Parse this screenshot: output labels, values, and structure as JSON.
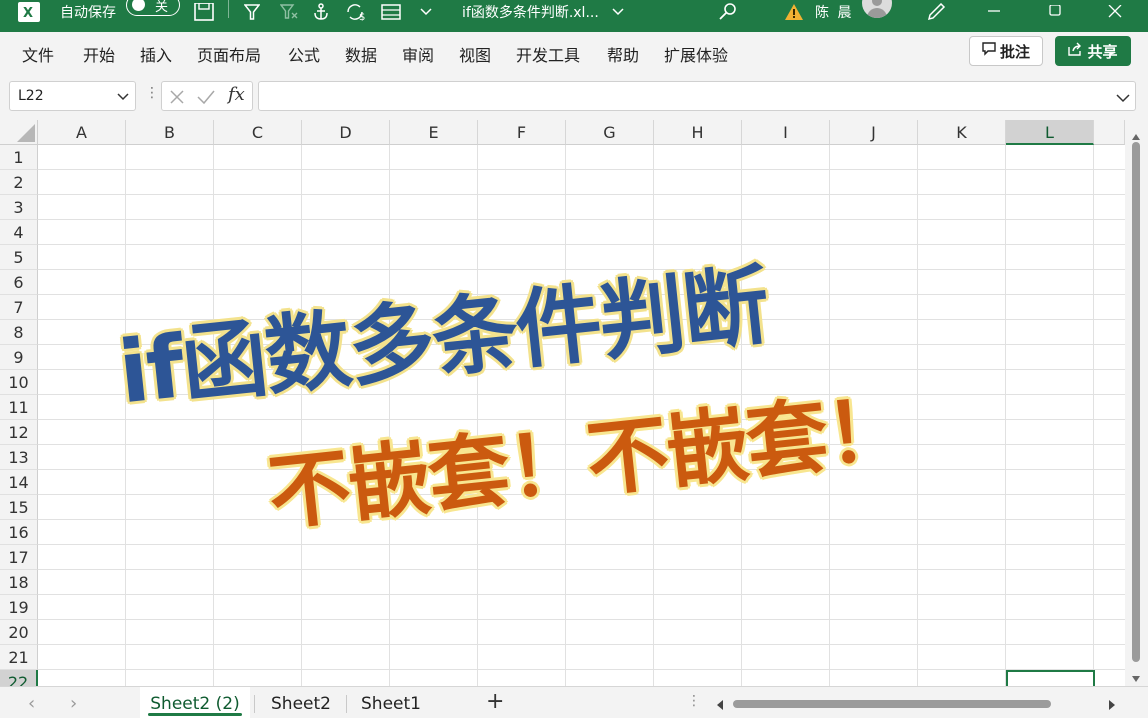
{
  "title_bar": {
    "autosave_label": "自动保存",
    "autosave_state": "关",
    "doc_title": "if函数多条件判断.xl...",
    "user_name": "陈 晨",
    "theme_color": "#1f7a45"
  },
  "menu": {
    "items": [
      "文件",
      "开始",
      "插入",
      "页面布局",
      "公式",
      "数据",
      "审阅",
      "视图",
      "开发工具",
      "帮助",
      "扩展体验"
    ],
    "comment_label": "批注",
    "share_label": "共享"
  },
  "formula_bar": {
    "name_box": "L22",
    "fx_label": "fx",
    "formula_value": ""
  },
  "grid": {
    "columns": [
      "A",
      "B",
      "C",
      "D",
      "E",
      "F",
      "G",
      "H",
      "I",
      "J",
      "K",
      "L"
    ],
    "rows": [
      "1",
      "2",
      "3",
      "4",
      "5",
      "6",
      "7",
      "8",
      "9",
      "10",
      "11",
      "12",
      "13",
      "14",
      "15",
      "16",
      "17",
      "18",
      "19",
      "20",
      "21",
      "22"
    ],
    "selected_column": "L",
    "selected_row": "22",
    "active_cell": "L22"
  },
  "overlay": {
    "line1": "if函数多条件判断",
    "line2": "不嵌套！不嵌套！",
    "line1_color": "#2d5596",
    "line2_color": "#cb5a0f",
    "outline_color": "#f3e28d"
  },
  "sheets": {
    "tabs": [
      "Sheet2 (2)",
      "Sheet2",
      "Sheet1"
    ],
    "active_index": 0,
    "add_label": "+"
  }
}
